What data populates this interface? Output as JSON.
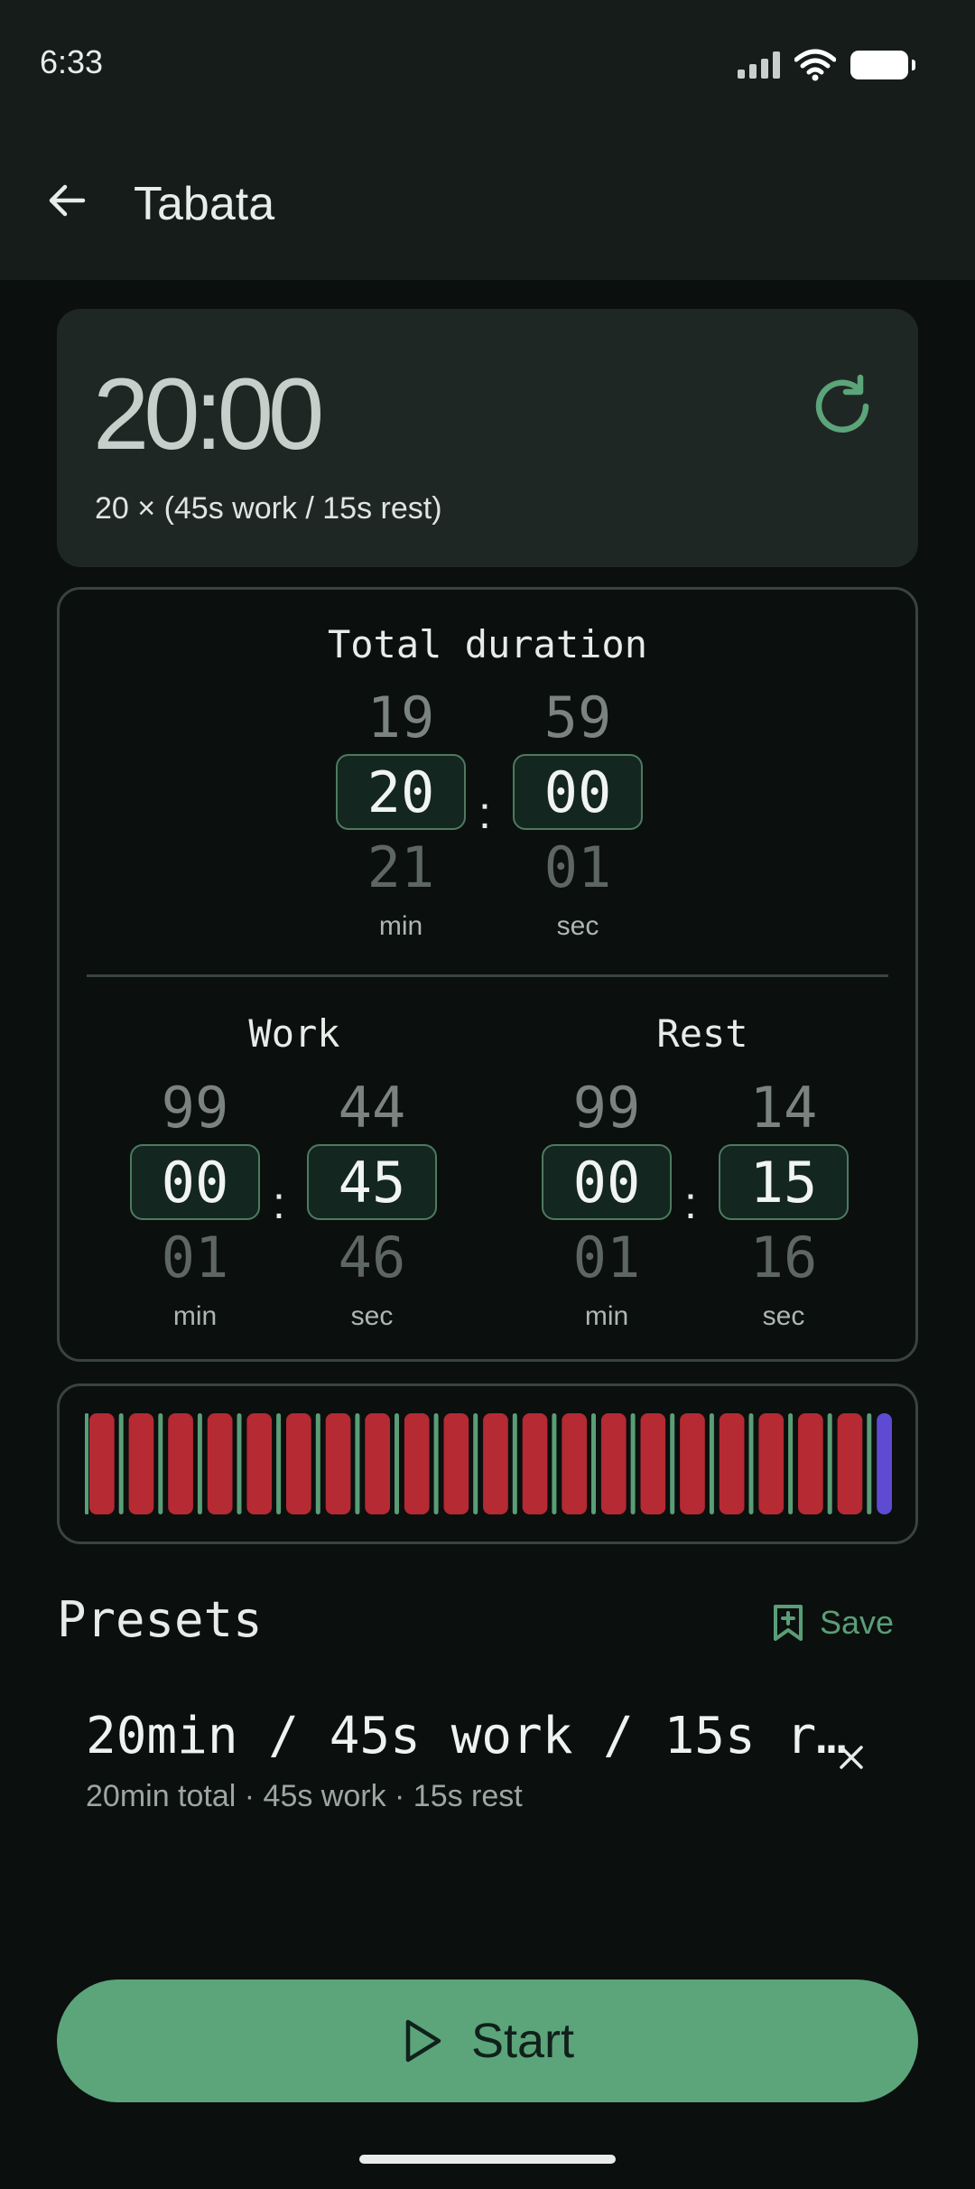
{
  "status": {
    "time": "6:33"
  },
  "app_bar": {
    "title": "Tabata"
  },
  "timer": {
    "value": "20:00",
    "summary": "20 × (45s work / 15s rest)"
  },
  "total_duration": {
    "label": "Total duration",
    "min": {
      "prev": "19",
      "current": "20",
      "next": "21",
      "unit": "min"
    },
    "sec": {
      "prev": "59",
      "current": "00",
      "next": "01",
      "unit": "sec"
    }
  },
  "work": {
    "label": "Work",
    "min": {
      "prev": "99",
      "current": "00",
      "next": "01",
      "unit": "min"
    },
    "sec": {
      "prev": "44",
      "current": "45",
      "next": "46",
      "unit": "sec"
    }
  },
  "rest": {
    "label": "Rest",
    "min": {
      "prev": "99",
      "current": "00",
      "next": "01",
      "unit": "min"
    },
    "sec": {
      "prev": "14",
      "current": "15",
      "next": "16",
      "unit": "sec"
    }
  },
  "intervals_bar": {
    "rounds": 20,
    "work_color": "#b52a33",
    "rest_color": "#5a9e77",
    "end_color": "#5f4bd1"
  },
  "presets": {
    "title": "Presets",
    "save_label": "Save",
    "items": [
      {
        "name": "20min / 45s work / 15s r…",
        "subtitle": "20min total · 45s work · 15s rest"
      }
    ]
  },
  "start": {
    "label": "Start"
  },
  "colors": {
    "accent": "#5ca47a",
    "surface": "#1f2725",
    "background": "#0b0f0e"
  }
}
